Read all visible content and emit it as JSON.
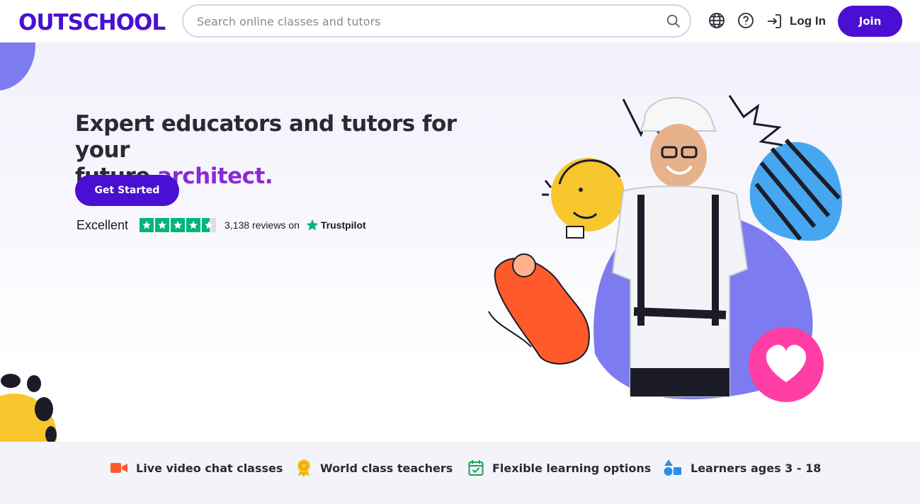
{
  "header": {
    "logo_text": "OUTSCHOOL",
    "search_placeholder": "Search online classes and tutors",
    "login_label": "Log In",
    "join_label": "Join",
    "icons": [
      "search-icon",
      "globe-icon",
      "help-icon",
      "login-icon"
    ]
  },
  "hero": {
    "headline_prefix": "Expert educators and tutors for your",
    "headline_line2_prefix": "future",
    "headline_accent": "architect.",
    "cta_label": "Get Started",
    "trustpilot": {
      "rating_word": "Excellent",
      "stars": 4.5,
      "reviews_text": "3,138 reviews on",
      "brand": "Trustpilot"
    }
  },
  "features": [
    {
      "label": "Live video chat classes",
      "icon": "video-camera-icon"
    },
    {
      "label": "World class teachers",
      "icon": "award-ribbon-icon"
    },
    {
      "label": "Flexible learning options",
      "icon": "calendar-check-icon"
    },
    {
      "label": "Learners ages 3 - 18",
      "icon": "shapes-icon"
    }
  ],
  "colors": {
    "brand_purple": "#4a0fd2",
    "accent_purple": "#8a2bd6",
    "trustpilot_green": "#00b67a",
    "pink": "#ff3ea5",
    "blob_purple": "#7c7cf0"
  }
}
